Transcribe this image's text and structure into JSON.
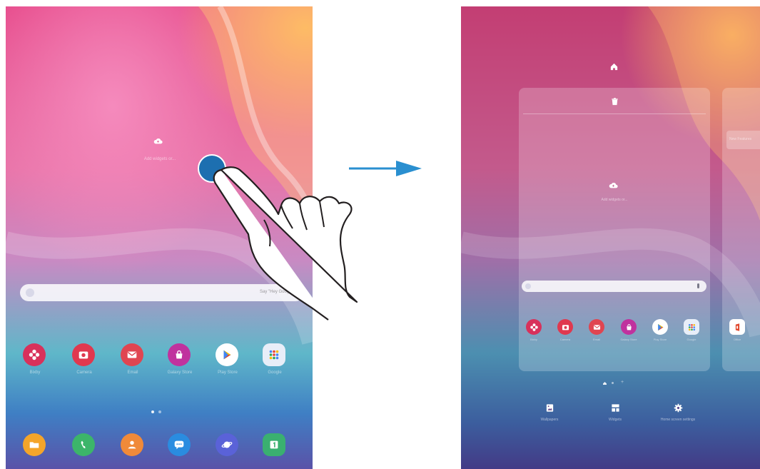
{
  "left_screen": {
    "add_widget_label": "Add widgets or...",
    "search_placeholder": "Say \"Hey Google\"",
    "apps": [
      {
        "name": "Bixby",
        "icon": "flower-icon",
        "color": "#d8315b"
      },
      {
        "name": "Camera",
        "icon": "camera-icon",
        "color": "#e0384f"
      },
      {
        "name": "Email",
        "icon": "mail-icon",
        "color": "#e04551"
      },
      {
        "name": "Galaxy Store",
        "icon": "bag-icon",
        "color": "#c0329e"
      },
      {
        "name": "Play Store",
        "icon": "play-icon",
        "color": "#ffffff"
      },
      {
        "name": "Google",
        "icon": "folder-grid-icon",
        "color": "#e8eef8"
      }
    ],
    "dock": [
      {
        "name": "My Files",
        "icon": "folder-icon",
        "color": "#f4a52a"
      },
      {
        "name": "Phone",
        "icon": "phone-icon",
        "color": "#3cb56a"
      },
      {
        "name": "Contacts",
        "icon": "person-icon",
        "color": "#f08a3a"
      },
      {
        "name": "Messages",
        "icon": "chat-icon",
        "color": "#2a8ce0"
      },
      {
        "name": "Internet",
        "icon": "planet-icon",
        "color": "#5a62d8"
      },
      {
        "name": "Calendar",
        "icon": "calendar-icon",
        "color": "#3ab070"
      }
    ]
  },
  "right_screen": {
    "add_widget_label": "Add widgets or...",
    "peek_label": "New Features",
    "apps": [
      {
        "name": "Bixby",
        "color": "#d8315b"
      },
      {
        "name": "Camera",
        "color": "#e0384f"
      },
      {
        "name": "Email",
        "color": "#e04551"
      },
      {
        "name": "Galaxy Store",
        "color": "#c0329e"
      },
      {
        "name": "Play Store",
        "color": "#ffffff"
      },
      {
        "name": "Google",
        "color": "#e8eef8"
      }
    ],
    "peek_app": {
      "name": "Office",
      "color": "#ffffff"
    },
    "bottom_options": [
      {
        "label": "Wallpapers",
        "icon": "image-icon"
      },
      {
        "label": "Widgets",
        "icon": "widgets-icon"
      },
      {
        "label": "Home screen settings",
        "icon": "gear-icon"
      }
    ]
  }
}
